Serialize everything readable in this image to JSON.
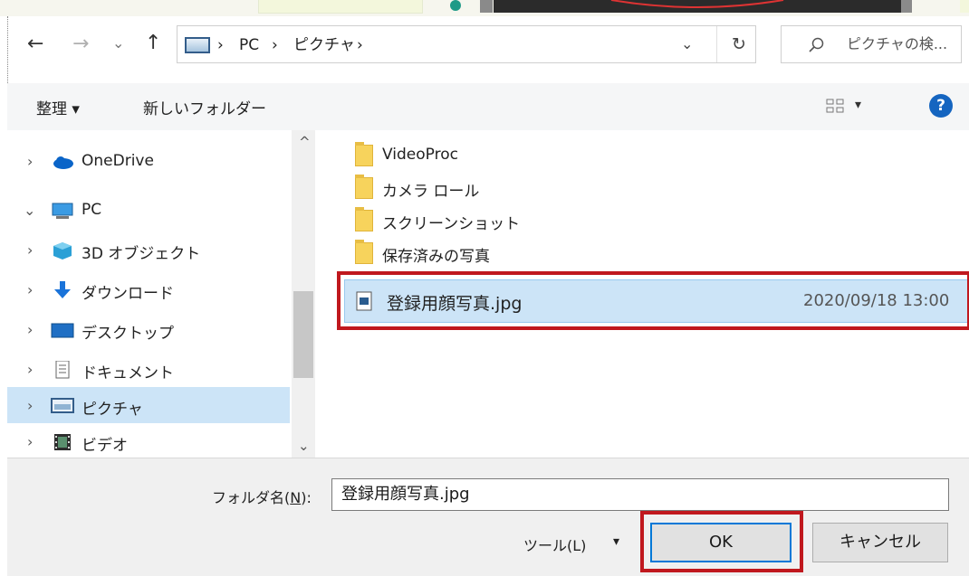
{
  "nav": {
    "back": "←",
    "forward": "→",
    "recent": "⌄",
    "up": "↑",
    "refresh": "↻",
    "dropdown": "⌄"
  },
  "address": {
    "segments": [
      "PC",
      "ピクチャ"
    ],
    "separator": "›"
  },
  "search": {
    "placeholder": "ピクチャの検..."
  },
  "toolbar": {
    "organize_label": "整理 ▾",
    "new_folder_label": "新しいフォルダー",
    "view_menu": "▾",
    "help": "?"
  },
  "sidebar": {
    "items": [
      {
        "label": "OneDrive",
        "chevron": "›",
        "icon": "cloud-icon"
      },
      {
        "label": "PC",
        "chevron": "⌄",
        "icon": "computer-icon"
      },
      {
        "label": "3D オブジェクト",
        "chevron": "›",
        "icon": "cube-icon"
      },
      {
        "label": "ダウンロード",
        "chevron": "›",
        "icon": "download-icon"
      },
      {
        "label": "デスクトップ",
        "chevron": "›",
        "icon": "desktop-icon"
      },
      {
        "label": "ドキュメント",
        "chevron": "›",
        "icon": "document-icon"
      },
      {
        "label": "ピクチャ",
        "chevron": "›",
        "icon": "picture-icon"
      },
      {
        "label": "ビデオ",
        "chevron": "›",
        "icon": "video-icon"
      }
    ],
    "scroll_up": "^",
    "scroll_down": "⌄"
  },
  "files": {
    "folders": [
      "VideoProc",
      "カメラ ロール",
      "スクリーンショット",
      "保存済みの写真"
    ],
    "selected_file": {
      "name": "登録用顔写真.jpg",
      "date": "2020/09/18 13:00"
    }
  },
  "bottom": {
    "filename_label": "フォルダ名(",
    "filename_accel": "N",
    "filename_label_end": "):",
    "filename_value": "登録用顔写真.jpg",
    "tools_label": "ツール(L)",
    "tools_arrow": "▾",
    "ok_label": "OK",
    "cancel_label": "キャンセル"
  },
  "colors": {
    "highlight_red": "#c0181e",
    "selection_blue": "#cce4f7",
    "accent_blue": "#0078d7",
    "help_blue": "#1565c0"
  }
}
